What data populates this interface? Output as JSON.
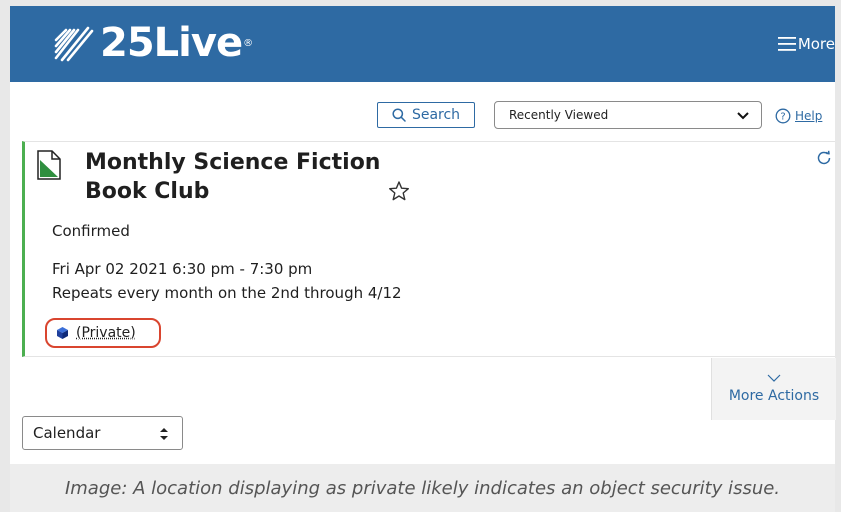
{
  "header": {
    "logo_text": "25Live",
    "logo_mark": "®",
    "menu_label": "More",
    "menu_icon": "hamburger-icon",
    "bg_color": "#2e6aa3"
  },
  "toolbar": {
    "search_label": "Search",
    "search_icon": "search-icon",
    "recent_select_value": "Recently Viewed",
    "help_label": "Help",
    "help_icon": "question-circle-icon"
  },
  "event": {
    "title": "Monthly Science Fiction Book Club",
    "status": "Confirmed",
    "date_time": "Fri Apr 02 2021 6:30 pm - 7:30 pm",
    "repeat": "Repeats every month on the 2nd through 4/12",
    "location_label": "(Private)",
    "location_icon": "cube-icon",
    "accent_color": "#4caf50",
    "highlight_color": "#d9452f"
  },
  "actions": {
    "more_actions_label": "More Actions"
  },
  "calendar_select": {
    "value": "Calendar"
  },
  "caption": "Image: A location displaying as private likely indicates an object security issue."
}
